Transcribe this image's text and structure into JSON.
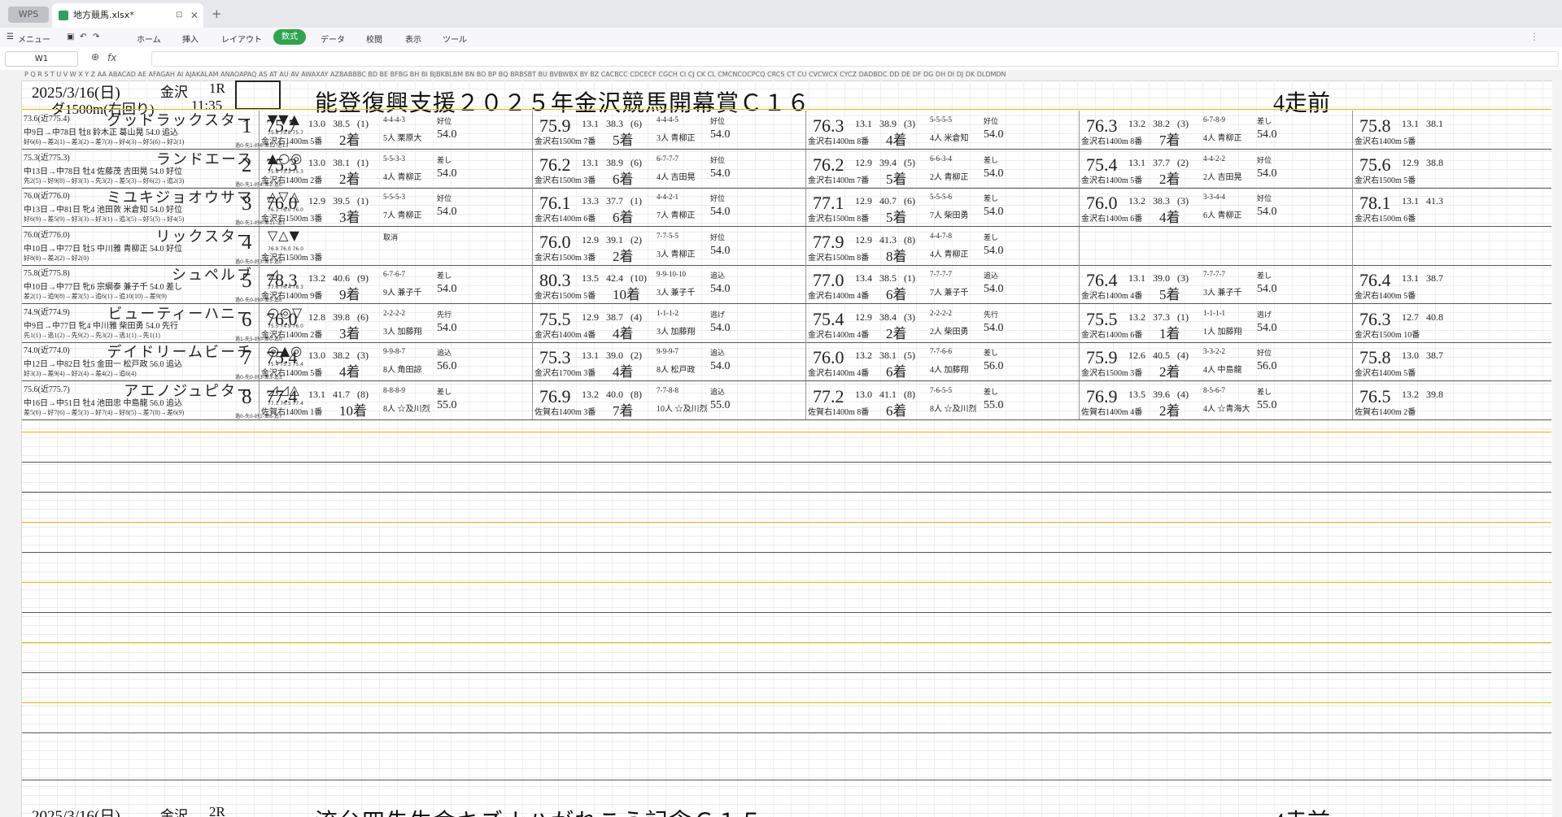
{
  "tabs": {
    "wps": "WPS",
    "file": "地方競馬.xlsx*"
  },
  "menu": {
    "menu": "メニュー",
    "home": "ホーム",
    "insert": "挿入",
    "layout": "レイアウト",
    "formula": "数式",
    "data": "データ",
    "review": "校閲",
    "view": "表示",
    "tools": "ツール"
  },
  "formula_bar": {
    "cell": "W1",
    "fx": "fx"
  },
  "column_headers": "P   Q   R   S   T   U   V   W   X  Y  Z  AA ABACAD AE AFAGAH AI AJAKALAM ANAOAPAQ AS AT AU AV AWAXAY AZBABBBC BD BE BFBG BH BI BJBKBLBM BN BO BP BQ BRBSBT BU BVBWBX BY BZ CACBCC CDCECF CGCH CI CJ CK CL CMCNCOCPCQ CRCS CT CU CVCWCX CYCZ DADBDC DD DE DF DG DH DI DJ DK DLDMDN",
  "race1": {
    "date": "2025/3/16(日)",
    "track": "金沢",
    "race_no": "1R",
    "distance": "ダ1500m(右回り)",
    "time": "11:35",
    "title": "能登復興支援２０２５年金沢競馬開幕賞Ｃ１６",
    "runs_label": "4走前"
  },
  "race2": {
    "date": "2025/3/16(日)",
    "track": "金沢",
    "race_no": "2R",
    "title": "流台四先生命キズナハがれこう記念Ｃ１５",
    "runs_label": "4走前"
  },
  "horses": [
    {
      "odds": "73.6(近775.4)",
      "name": "グッドラックスター",
      "info": "中9日→中78日 牡8 鈴木正 葛山晃 54.0 追込",
      "hist": "好6(6)→差2(1)→差3(2)→差7(3)→好4(3)→好5(6)→好2(1)",
      "num": "1",
      "marks": "▼▼▲",
      "sub": "75.8 75.8 75.7",
      "subb": "過0-先1-好6-差12-追13",
      "runs": [
        {
          "big": "75.7",
          "s1": "13.0",
          "s2": "38.5",
          "s3": "(1)",
          "place": "2着",
          "course": "金沢右1400m 5番",
          "mid": "4-4-4-3",
          "jock": "5人 栗原大",
          "wt": "54.0",
          "pos": "好位"
        },
        {
          "big": "75.9",
          "s1": "13.1",
          "s2": "38.3",
          "s3": "(6)",
          "place": "5着",
          "course": "金沢右1500m 7番",
          "mid": "4-4-4-5",
          "jock": "3人 青柳正",
          "wt": "54.0",
          "pos": "好位"
        },
        {
          "big": "76.3",
          "s1": "13.1",
          "s2": "38.9",
          "s3": "(3)",
          "place": "4着",
          "course": "金沢右1400m 8番",
          "mid": "5-5-5-5",
          "jock": "4人 米倉知",
          "wt": "54.0",
          "pos": "好位"
        },
        {
          "big": "76.3",
          "s1": "13.2",
          "s2": "38.2",
          "s3": "(3)",
          "place": "7着",
          "course": "金沢右1400m 8番",
          "mid": "6-7-8-9",
          "jock": "4人 青柳正",
          "wt": "54.0",
          "pos": "差し"
        },
        {
          "big": "75.8",
          "s1": "13.1",
          "s2": "38.1",
          "s3": "",
          "place": "",
          "course": "金沢右1400m 5番",
          "mid": "",
          "jock": "",
          "wt": "",
          "pos": ""
        }
      ]
    },
    {
      "odds": "75.3(近775.3)",
      "name": "ランドエース",
      "info": "中13日→中78日 牡4 佐藤茂 吉田晃 54.0 好位",
      "hist": "先2(5)→好9(8)→好3(3)→先3(2)→差5(3)→好6(2)→追2(3)",
      "num": "2",
      "marks": "▲○◎",
      "sub": "75.8 75.3 75.3",
      "subb": "過0-先1-好4-差2-追0",
      "runs": [
        {
          "big": "75.3",
          "s1": "13.0",
          "s2": "38.1",
          "s3": "(1)",
          "place": "2着",
          "course": "金沢右1400m 2番",
          "mid": "5-5-3-3",
          "jock": "4人 青柳正",
          "wt": "54.0",
          "pos": "差し"
        },
        {
          "big": "76.2",
          "s1": "13.1",
          "s2": "38.9",
          "s3": "(6)",
          "place": "6着",
          "course": "金沢右1500m 3番",
          "mid": "6-7-7-7",
          "jock": "4人 吉田晃",
          "wt": "54.0",
          "pos": "好位"
        },
        {
          "big": "76.2",
          "s1": "12.9",
          "s2": "39.4",
          "s3": "(5)",
          "place": "5着",
          "course": "金沢右1400m 7番",
          "mid": "6-6-3-4",
          "jock": "2人 青柳正",
          "wt": "54.0",
          "pos": "差し"
        },
        {
          "big": "75.4",
          "s1": "13.1",
          "s2": "37.7",
          "s3": "(2)",
          "place": "2着",
          "course": "金沢右1400m 5番",
          "mid": "4-4-2-2",
          "jock": "2人 吉田晃",
          "wt": "54.0",
          "pos": "好位"
        },
        {
          "big": "75.6",
          "s1": "12.9",
          "s2": "38.8",
          "s3": "",
          "place": "",
          "course": "金沢右1500m 5番",
          "mid": "",
          "jock": "",
          "wt": "",
          "pos": ""
        }
      ]
    },
    {
      "odds": "76.0(近776.0)",
      "name": "ミユキジョオウサマ",
      "info": "中13日→中81日 牝4 池田敦 米倉知 54.0 好位",
      "hist": "好6(9)→差5(9)→好3(3)→好3(1)→追3(5)→好5(5)→好4(5)",
      "num": "3",
      "marks": "△▽△",
      "sub": "76.1 76.0 76.0",
      "subb": "過0-先1-好6-差11-追1",
      "runs": [
        {
          "big": "76.0",
          "s1": "12.9",
          "s2": "39.5",
          "s3": "(1)",
          "place": "3着",
          "course": "金沢右1500m 3番",
          "mid": "5-5-5-3",
          "jock": "7人 青柳正",
          "wt": "54.0",
          "pos": "好位"
        },
        {
          "big": "76.1",
          "s1": "13.3",
          "s2": "37.7",
          "s3": "(1)",
          "place": "6着",
          "course": "金沢右1400m 6番",
          "mid": "4-4-2-1",
          "jock": "7人 青柳正",
          "wt": "54.0",
          "pos": "好位"
        },
        {
          "big": "77.1",
          "s1": "12.9",
          "s2": "40.7",
          "s3": "(6)",
          "place": "5着",
          "course": "金沢右1500m 8番",
          "mid": "5-5-5-6",
          "jock": "7人 柴田勇",
          "wt": "54.0",
          "pos": "差し"
        },
        {
          "big": "76.0",
          "s1": "13.2",
          "s2": "38.3",
          "s3": "(3)",
          "place": "4着",
          "course": "金沢右1400m 6番",
          "mid": "3-3-4-4",
          "jock": "6人 青柳正",
          "wt": "54.0",
          "pos": "好位"
        },
        {
          "big": "78.1",
          "s1": "13.1",
          "s2": "41.3",
          "s3": "",
          "place": "",
          "course": "金沢右1500m 6番",
          "mid": "",
          "jock": "",
          "wt": "",
          "pos": ""
        }
      ]
    },
    {
      "odds": "76.0(近776.0)",
      "name": "リックスター",
      "info": "中10日→中77日 牡5 中川雅 青柳正 54.0 好位",
      "hist": "好8(8)→差2(2)→好2(0)",
      "num": "4",
      "marks": "▽△▼",
      "sub": "76.9 76.0 76.0",
      "subb": "過0-先0-好3-差1-追0",
      "runs": [
        {
          "big": "",
          "s1": "",
          "s2": "",
          "s3": "",
          "place": "",
          "course": "金沢右1500m 3番",
          "mid": "取消",
          "jock": "",
          "wt": "",
          "pos": ""
        },
        {
          "big": "76.0",
          "s1": "12.9",
          "s2": "39.1",
          "s3": "(2)",
          "place": "2着",
          "course": "金沢右1500m 3番",
          "mid": "7-7-5-5",
          "jock": "3人 青柳正",
          "wt": "54.0",
          "pos": "好位"
        },
        {
          "big": "77.9",
          "s1": "12.9",
          "s2": "41.3",
          "s3": "(8)",
          "place": "8着",
          "course": "金沢右1500m 8番",
          "mid": "4-4-7-8",
          "jock": "4人 青柳正",
          "wt": "54.0",
          "pos": "差し"
        },
        {
          "big": "",
          "s1": "",
          "s2": "",
          "s3": "",
          "place": "",
          "course": "",
          "mid": "",
          "jock": "",
          "wt": "",
          "pos": ""
        },
        {
          "big": "",
          "s1": "",
          "s2": "",
          "s3": "",
          "place": "",
          "course": "",
          "mid": "",
          "jock": "",
          "wt": "",
          "pos": ""
        }
      ]
    },
    {
      "odds": "75.8(近775.8)",
      "name": "シュペルブ",
      "info": "中10日→中77日 牝6 宗綱泰 兼子千 54.0 差し",
      "hist": "差2(1)→追9(8)→差3(5)→追6(1)→追10(10)→差9(9)",
      "num": "5",
      "marks": "◿",
      "sub": "77.6 76.4 78.3",
      "subb": "過0-先0-好0-差5-追6",
      "runs": [
        {
          "big": "78.3",
          "s1": "13.2",
          "s2": "40.6",
          "s3": "(9)",
          "place": "9着",
          "course": "金沢右1400m 9番",
          "mid": "6-7-6-7",
          "jock": "9人 兼子千",
          "wt": "54.0",
          "pos": "差し"
        },
        {
          "big": "80.3",
          "s1": "13.5",
          "s2": "42.4",
          "s3": "(10)",
          "place": "10着",
          "course": "金沢右1500m 5番",
          "mid": "9-9-10-10",
          "jock": "3人 兼子千",
          "wt": "54.0",
          "pos": "追込"
        },
        {
          "big": "77.0",
          "s1": "13.4",
          "s2": "38.5",
          "s3": "(1)",
          "place": "6着",
          "course": "金沢右1400m 4番",
          "mid": "7-7-7-7",
          "jock": "7人 兼子千",
          "wt": "54.0",
          "pos": "追込"
        },
        {
          "big": "76.4",
          "s1": "13.1",
          "s2": "39.0",
          "s3": "(3)",
          "place": "5着",
          "course": "金沢右1400m 4番",
          "mid": "7-7-7-7",
          "jock": "3人 兼子千",
          "wt": "54.0",
          "pos": "差し"
        },
        {
          "big": "76.4",
          "s1": "13.1",
          "s2": "38.7",
          "s3": "",
          "place": "",
          "course": "金沢右1400m 5番",
          "mid": "",
          "jock": "",
          "wt": "",
          "pos": ""
        }
      ]
    },
    {
      "odds": "74.9(近774.9)",
      "name": "ビューティーハニー",
      "info": "中9日→中77日 牝4 中川雅 柴田勇 54.0 先行",
      "hist": "先1(1)→逃1(2)→先9(2)→先3(2)→逃1(1)→先1(1)",
      "num": "6",
      "marks": "○◎▽",
      "sub": "75.5 74.9 76.0",
      "subb": "過1-先5-好0-差0-追0",
      "runs": [
        {
          "big": "76.0",
          "s1": "12.8",
          "s2": "39.8",
          "s3": "(6)",
          "place": "3着",
          "course": "金沢右1400m 2番",
          "mid": "2-2-2-2",
          "jock": "3人 加藤翔",
          "wt": "54.0",
          "pos": "先行"
        },
        {
          "big": "75.5",
          "s1": "12.9",
          "s2": "38.7",
          "s3": "(4)",
          "place": "4着",
          "course": "金沢右1400m 4番",
          "mid": "1-1-1-2",
          "jock": "3人 加藤翔",
          "wt": "54.0",
          "pos": "逃げ"
        },
        {
          "big": "75.4",
          "s1": "12.9",
          "s2": "38.4",
          "s3": "(3)",
          "place": "2着",
          "course": "金沢右1400m 4番",
          "mid": "2-2-2-2",
          "jock": "2人 柴田勇",
          "wt": "54.0",
          "pos": "先行"
        },
        {
          "big": "75.5",
          "s1": "13.2",
          "s2": "37.3",
          "s3": "(1)",
          "place": "1着",
          "course": "金沢右1400m 6番",
          "mid": "1-1-1-1",
          "jock": "1人 加藤翔",
          "wt": "54.0",
          "pos": "逃げ"
        },
        {
          "big": "76.3",
          "s1": "12.7",
          "s2": "40.8",
          "s3": "",
          "place": "",
          "course": "金沢右1500m 10番",
          "mid": "",
          "jock": "",
          "wt": "",
          "pos": ""
        }
      ]
    },
    {
      "odds": "74.0(近774.0)",
      "name": "デイドリームビーチ",
      "info": "中12日→中82日 牡5 金田一 松戸政 56.0 追込",
      "hist": "好3(3)→差9(4)→好2(4)→差4(2)→追6(4)",
      "num": "7",
      "marks": "◎▲◎",
      "sub": "75.4 75.3 75.4",
      "subb": "過0-先0-好3-差3-追3",
      "runs": [
        {
          "big": "75.4",
          "s1": "13.0",
          "s2": "38.2",
          "s3": "(3)",
          "place": "4着",
          "course": "金沢右1400m 5番",
          "mid": "9-9-8-7",
          "jock": "8人 角田諒",
          "wt": "56.0",
          "pos": "追込"
        },
        {
          "big": "75.3",
          "s1": "13.1",
          "s2": "39.0",
          "s3": "(2)",
          "place": "4着",
          "course": "金沢右1700m 3番",
          "mid": "9-9-9-7",
          "jock": "8人 松戸政",
          "wt": "54.0",
          "pos": "追込"
        },
        {
          "big": "76.0",
          "s1": "13.2",
          "s2": "38.1",
          "s3": "(5)",
          "place": "6着",
          "course": "金沢右1400m 4番",
          "mid": "7-7-6-6",
          "jock": "4人 加藤翔",
          "wt": "56.0",
          "pos": "差し"
        },
        {
          "big": "75.9",
          "s1": "12.6",
          "s2": "40.5",
          "s3": "(4)",
          "place": "2着",
          "course": "金沢右1500m 3番",
          "mid": "3-3-2-2",
          "jock": "4人 中島龍",
          "wt": "56.0",
          "pos": "好位"
        },
        {
          "big": "75.8",
          "s1": "13.0",
          "s2": "38.7",
          "s3": "",
          "place": "",
          "course": "金沢右1400m 5番",
          "mid": "",
          "jock": "",
          "wt": "",
          "pos": ""
        }
      ]
    },
    {
      "odds": "75.6(近775.7)",
      "name": "アエノジュピター",
      "info": "中16日→中51日 牡4 池田忠 中島龍 56.0 追込",
      "hist": "差5(6)→好7(6)→差5(3)→好7(4)→好8(5)→差7(8)→差6(9)",
      "num": "8",
      "marks": "◿◿△",
      "sub": "77.1 76.5 77.4",
      "subb": "過0-先0-好1-差6-追7",
      "runs": [
        {
          "big": "77.4",
          "s1": "13.1",
          "s2": "41.7",
          "s3": "(8)",
          "place": "10着",
          "course": "佐賀右1400m 1番",
          "mid": "8-8-8-9",
          "jock": "8人 ☆及川烈",
          "wt": "55.0",
          "pos": "差し"
        },
        {
          "big": "76.9",
          "s1": "13.2",
          "s2": "40.0",
          "s3": "(8)",
          "place": "7着",
          "course": "佐賀右1400m 3番",
          "mid": "7-7-8-8",
          "jock": "10人 ☆及川烈",
          "wt": "55.0",
          "pos": "追込"
        },
        {
          "big": "77.2",
          "s1": "13.0",
          "s2": "41.1",
          "s3": "(8)",
          "place": "6着",
          "course": "佐賀右1400m 8番",
          "mid": "7-6-5-5",
          "jock": "8人 ☆及川烈",
          "wt": "55.0",
          "pos": "差し"
        },
        {
          "big": "76.9",
          "s1": "13.5",
          "s2": "39.6",
          "s3": "(4)",
          "place": "2着",
          "course": "佐賀右1400m 4番",
          "mid": "8-5-6-7",
          "jock": "4人 ☆青海大",
          "wt": "55.0",
          "pos": "差し"
        },
        {
          "big": "76.5",
          "s1": "13.2",
          "s2": "39.8",
          "s3": "",
          "place": "",
          "course": "佐賀右1400m 2番",
          "mid": "",
          "jock": "",
          "wt": "",
          "pos": ""
        }
      ]
    }
  ]
}
